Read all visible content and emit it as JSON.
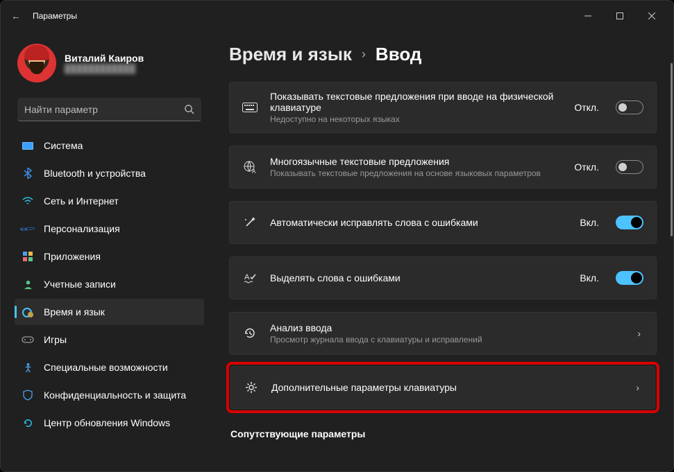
{
  "window": {
    "title": "Параметры"
  },
  "profile": {
    "name": "Виталий Каиров",
    "email": "blurred"
  },
  "search": {
    "placeholder": "Найти параметр"
  },
  "sidebar": {
    "items": [
      {
        "label": "Система"
      },
      {
        "label": "Bluetooth и устройства"
      },
      {
        "label": "Сеть и Интернет"
      },
      {
        "label": "Персонализация"
      },
      {
        "label": "Приложения"
      },
      {
        "label": "Учетные записи"
      },
      {
        "label": "Время и язык"
      },
      {
        "label": "Игры"
      },
      {
        "label": "Специальные возможности"
      },
      {
        "label": "Конфиденциальность и защита"
      },
      {
        "label": "Центр обновления Windows"
      }
    ]
  },
  "breadcrumb": {
    "parent": "Время и язык",
    "sep": "›",
    "current": "Ввод"
  },
  "cards": [
    {
      "title": "Показывать текстовые предложения при вводе на физической клавиатуре",
      "sub": "Недоступно на некоторых языках",
      "state": "Откл.",
      "on": false
    },
    {
      "title": "Многоязычные текстовые предложения",
      "sub": "Показывать текстовые предложения на основе языковых параметров",
      "state": "Откл.",
      "on": false
    },
    {
      "title": "Автоматически исправлять слова с ошибками",
      "sub": "",
      "state": "Вкл.",
      "on": true
    },
    {
      "title": "Выделять слова с ошибками",
      "sub": "",
      "state": "Вкл.",
      "on": true
    },
    {
      "title": "Анализ ввода",
      "sub": "Просмотр журнала ввода с клавиатуры и исправлений",
      "nav": true
    },
    {
      "title": "Дополнительные параметры клавиатуры",
      "sub": "",
      "nav": true,
      "highlight": true
    }
  ],
  "related_label": "Сопутствующие параметры"
}
